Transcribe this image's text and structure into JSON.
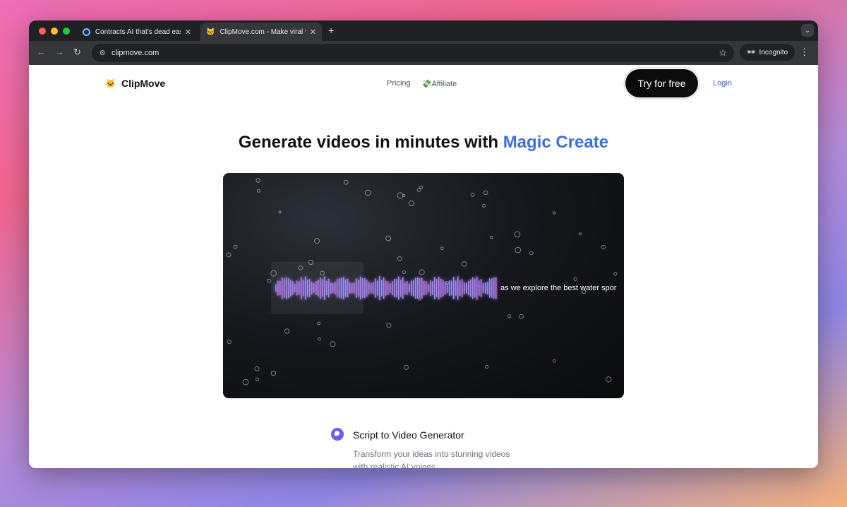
{
  "browser": {
    "tabs": [
      {
        "title": "Contracts AI that's dead easy",
        "active": false
      },
      {
        "title": "ClipMove.com - Make viral videos",
        "active": true
      }
    ],
    "url": "clipmove.com",
    "incognito_label": "Incognito"
  },
  "site": {
    "logo_text": "ClipMove",
    "nav": [
      "Pricing",
      "💸Affiliate"
    ],
    "cta": "Try for free",
    "login": "Login"
  },
  "hero": {
    "headline": "Generate videos in minutes with ",
    "headline_accent": "Magic Create",
    "video_caption": "as we explore the best water spor"
  },
  "feature": {
    "title": "Script to Video Generator",
    "description": "Transform your ideas into stunning videos with realistic AI voices."
  },
  "colors": {
    "accent": "#3a6fe0",
    "feature_icon": "#6f5de8",
    "wave_start": "#2ad7f5",
    "wave_end": "#ff33d2"
  }
}
